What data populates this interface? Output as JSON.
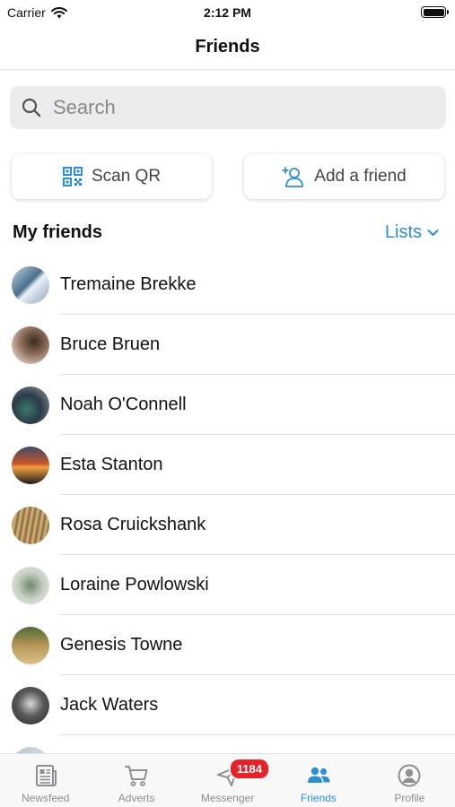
{
  "status_bar": {
    "carrier": "Carrier",
    "time": "2:12 PM"
  },
  "nav": {
    "title": "Friends"
  },
  "search": {
    "placeholder": "Search",
    "value": ""
  },
  "actions": {
    "scan_qr": "Scan QR",
    "add_friend": "Add a friend"
  },
  "section": {
    "title": "My friends",
    "lists_label": "Lists"
  },
  "friends": [
    {
      "name": "Tremaine Brekke"
    },
    {
      "name": "Bruce Bruen"
    },
    {
      "name": "Noah O'Connell"
    },
    {
      "name": "Esta Stanton"
    },
    {
      "name": "Rosa Cruickshank"
    },
    {
      "name": "Loraine Powlowski"
    },
    {
      "name": "Genesis Towne"
    },
    {
      "name": "Jack Waters"
    }
  ],
  "tabs": [
    {
      "label": "Newsfeed",
      "icon": "newspaper-icon"
    },
    {
      "label": "Adverts",
      "icon": "cart-icon"
    },
    {
      "label": "Messenger",
      "icon": "paper-plane-icon",
      "badge": "1184"
    },
    {
      "label": "Friends",
      "icon": "people-icon",
      "active": true
    },
    {
      "label": "Profile",
      "icon": "person-circle-icon"
    }
  ],
  "colors": {
    "accent": "#2c8fd6",
    "badge": "#e8202a"
  }
}
